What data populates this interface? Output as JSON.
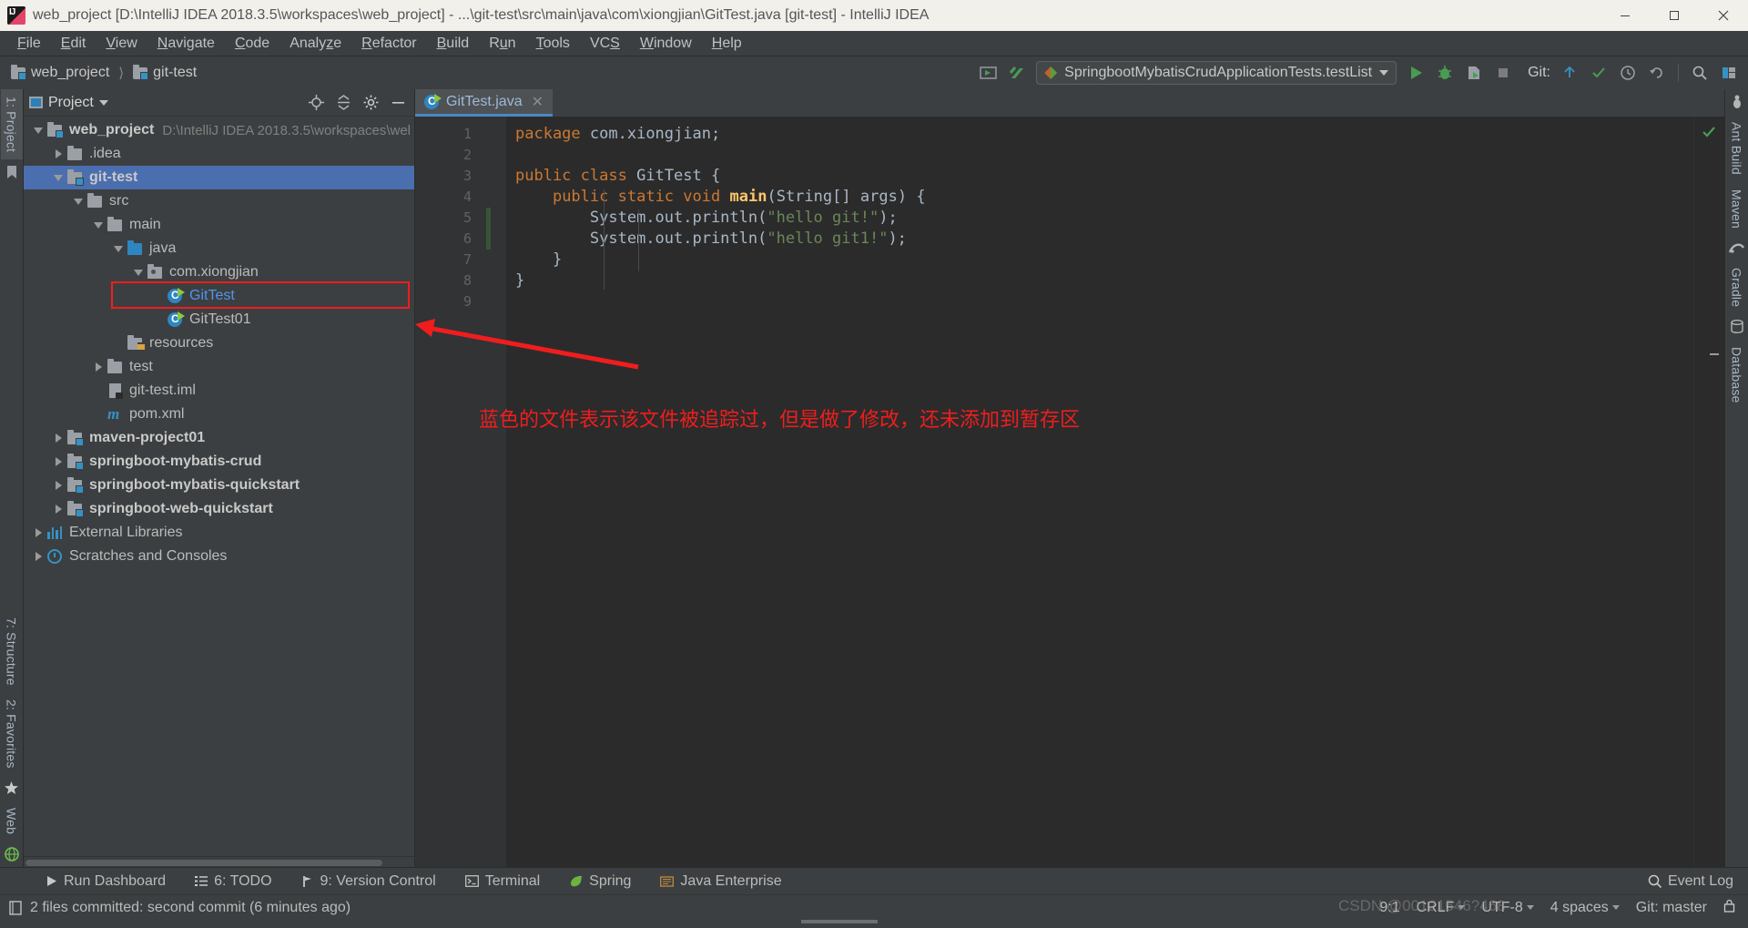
{
  "titlebar": {
    "title": "web_project [D:\\IntelliJ IDEA 2018.3.5\\workspaces\\web_project] - ...\\git-test\\src\\main\\java\\com\\xiongjian\\GitTest.java [git-test] - IntelliJ IDEA",
    "minimize": "minimize-icon",
    "maximize": "maximize-icon",
    "close": "close-icon"
  },
  "menu": {
    "items": [
      {
        "label": "File",
        "mnemonic": "F"
      },
      {
        "label": "Edit",
        "mnemonic": "E"
      },
      {
        "label": "View",
        "mnemonic": "V"
      },
      {
        "label": "Navigate",
        "mnemonic": "N"
      },
      {
        "label": "Code",
        "mnemonic": "C"
      },
      {
        "label": "Analyze",
        "mnemonic": "z"
      },
      {
        "label": "Refactor",
        "mnemonic": "R"
      },
      {
        "label": "Build",
        "mnemonic": "B"
      },
      {
        "label": "Run",
        "mnemonic": "u"
      },
      {
        "label": "Tools",
        "mnemonic": "T"
      },
      {
        "label": "VCS",
        "mnemonic": "S"
      },
      {
        "label": "Window",
        "mnemonic": "W"
      },
      {
        "label": "Help",
        "mnemonic": "H"
      }
    ]
  },
  "toolbar": {
    "breadcrumb": [
      "web_project",
      "git-test"
    ],
    "run_configuration": "SpringbootMybatisCrudApplicationTests.testList",
    "git_label": "Git:",
    "buttons": [
      "sync-button",
      "build-button",
      "run-button",
      "debug-button",
      "run-coverage-button",
      "stop-button",
      "git-update-button",
      "git-commit-button",
      "git-history-button",
      "git-revert-button",
      "search-button",
      "settings-button"
    ]
  },
  "project_panel": {
    "title": "Project",
    "header_buttons": [
      "locate-icon",
      "collapse-all-icon",
      "gear-icon",
      "hide-icon"
    ],
    "tree": [
      {
        "label": "web_project",
        "path": "D:\\IntelliJ IDEA 2018.3.5\\workspaces\\wel",
        "depth": 0,
        "arrow": "open",
        "icon": "folder-module-icon",
        "bold": true,
        "selected": false
      },
      {
        "label": ".idea",
        "path": "",
        "depth": 1,
        "arrow": "closed",
        "icon": "folder-icon",
        "bold": false,
        "selected": false
      },
      {
        "label": "git-test",
        "path": "",
        "depth": 1,
        "arrow": "open",
        "icon": "folder-module-icon",
        "bold": true,
        "selected": true
      },
      {
        "label": "src",
        "path": "",
        "depth": 2,
        "arrow": "open",
        "icon": "folder-icon",
        "bold": false,
        "selected": false
      },
      {
        "label": "main",
        "path": "",
        "depth": 3,
        "arrow": "open",
        "icon": "folder-icon",
        "bold": false,
        "selected": false
      },
      {
        "label": "java",
        "path": "",
        "depth": 4,
        "arrow": "open",
        "icon": "folder-source-icon",
        "bold": false,
        "selected": false
      },
      {
        "label": "com.xiongjian",
        "path": "",
        "depth": 5,
        "arrow": "open",
        "icon": "package-icon",
        "bold": false,
        "selected": false
      },
      {
        "label": "GitTest",
        "path": "",
        "depth": 6,
        "arrow": "none",
        "icon": "java-class-icon",
        "bold": false,
        "selected": false,
        "color": "blue",
        "annotated": true
      },
      {
        "label": "GitTest01",
        "path": "",
        "depth": 6,
        "arrow": "none",
        "icon": "java-class-icon",
        "bold": false,
        "selected": false
      },
      {
        "label": "resources",
        "path": "",
        "depth": 4,
        "arrow": "none",
        "icon": "folder-resources-icon",
        "bold": false,
        "selected": false
      },
      {
        "label": "test",
        "path": "",
        "depth": 3,
        "arrow": "closed",
        "icon": "folder-icon",
        "bold": false,
        "selected": false
      },
      {
        "label": "git-test.iml",
        "path": "",
        "depth": 3,
        "arrow": "none",
        "icon": "iml-file-icon",
        "bold": false,
        "selected": false
      },
      {
        "label": "pom.xml",
        "path": "",
        "depth": 3,
        "arrow": "none",
        "icon": "maven-file-icon",
        "bold": false,
        "selected": false
      },
      {
        "label": "maven-project01",
        "path": "",
        "depth": 1,
        "arrow": "closed",
        "icon": "folder-module-icon",
        "bold": true,
        "selected": false
      },
      {
        "label": "springboot-mybatis-crud",
        "path": "",
        "depth": 1,
        "arrow": "closed",
        "icon": "folder-module-icon",
        "bold": true,
        "selected": false
      },
      {
        "label": "springboot-mybatis-quickstart",
        "path": "",
        "depth": 1,
        "arrow": "closed",
        "icon": "folder-module-icon",
        "bold": true,
        "selected": false
      },
      {
        "label": "springboot-web-quickstart",
        "path": "",
        "depth": 1,
        "arrow": "closed",
        "icon": "folder-module-icon",
        "bold": true,
        "selected": false
      },
      {
        "label": "External Libraries",
        "path": "",
        "depth": 0,
        "arrow": "closed",
        "icon": "library-icon",
        "bold": false,
        "selected": false
      },
      {
        "label": "Scratches and Consoles",
        "path": "",
        "depth": 0,
        "arrow": "closed",
        "icon": "scratch-icon",
        "bold": false,
        "selected": false
      }
    ]
  },
  "editor": {
    "tab": {
      "label": "GitTest.java",
      "icon": "java-class-icon",
      "close": "close-tab-icon"
    },
    "lines": [
      {
        "n": 1,
        "run": false,
        "fold": false
      },
      {
        "n": 2,
        "run": false,
        "fold": false
      },
      {
        "n": 3,
        "run": true,
        "fold": false
      },
      {
        "n": 4,
        "run": true,
        "fold": true
      },
      {
        "n": 5,
        "run": false,
        "fold": false
      },
      {
        "n": 6,
        "run": false,
        "fold": false
      },
      {
        "n": 7,
        "run": false,
        "fold": false
      },
      {
        "n": 8,
        "run": false,
        "fold": false
      },
      {
        "n": 9,
        "run": false,
        "fold": false
      }
    ],
    "code": [
      "package com.xiongjian;",
      "",
      "public class GitTest {",
      "    public static void main(String[] args) {",
      "        System.out.println(\"hello git!\");",
      "        System.out.println(\"hello git1!\");",
      "    }",
      "}",
      ""
    ]
  },
  "annotation": {
    "text": "蓝色的文件表示该文件被追踪过，但是做了修改，还未添加到暂存区",
    "color": "#f01d1d"
  },
  "watermark": "CSDN @00121546?468",
  "left_strip": {
    "items": [
      {
        "label": "1: Project",
        "active": true
      },
      {
        "label": "",
        "icon": "bookmark-icon",
        "active": false
      },
      {
        "label": "7: Structure",
        "active": false
      },
      {
        "label": "2: Favorites",
        "active": false
      },
      {
        "label": "Web",
        "active": false
      }
    ]
  },
  "right_strip": {
    "items": [
      {
        "label": "Ant Build",
        "icon": "ant-icon"
      },
      {
        "label": "Maven",
        "icon": "maven-icon"
      },
      {
        "label": "Gradle",
        "icon": "gradle-icon"
      },
      {
        "label": "Database",
        "icon": "database-icon"
      }
    ]
  },
  "bottom_bar": {
    "items": [
      {
        "label": "Run Dashboard",
        "icon": "play-icon",
        "mnemonic": ""
      },
      {
        "label": "6: TODO",
        "icon": "todo-icon",
        "mnemonic": "6"
      },
      {
        "label": "9: Version Control",
        "icon": "vcs-icon",
        "mnemonic": "9"
      },
      {
        "label": "Terminal",
        "icon": "terminal-icon",
        "mnemonic": ""
      },
      {
        "label": "Spring",
        "icon": "spring-icon",
        "mnemonic": ""
      },
      {
        "label": "Java Enterprise",
        "icon": "java-ee-icon",
        "mnemonic": ""
      }
    ],
    "event_log": "Event Log"
  },
  "status_bar": {
    "message": "2 files committed: second commit (6 minutes ago)",
    "caret": "9:1",
    "line_sep": "CRLF",
    "encoding": "UTF-8",
    "indent": "4 spaces",
    "branch": "Git: master"
  }
}
